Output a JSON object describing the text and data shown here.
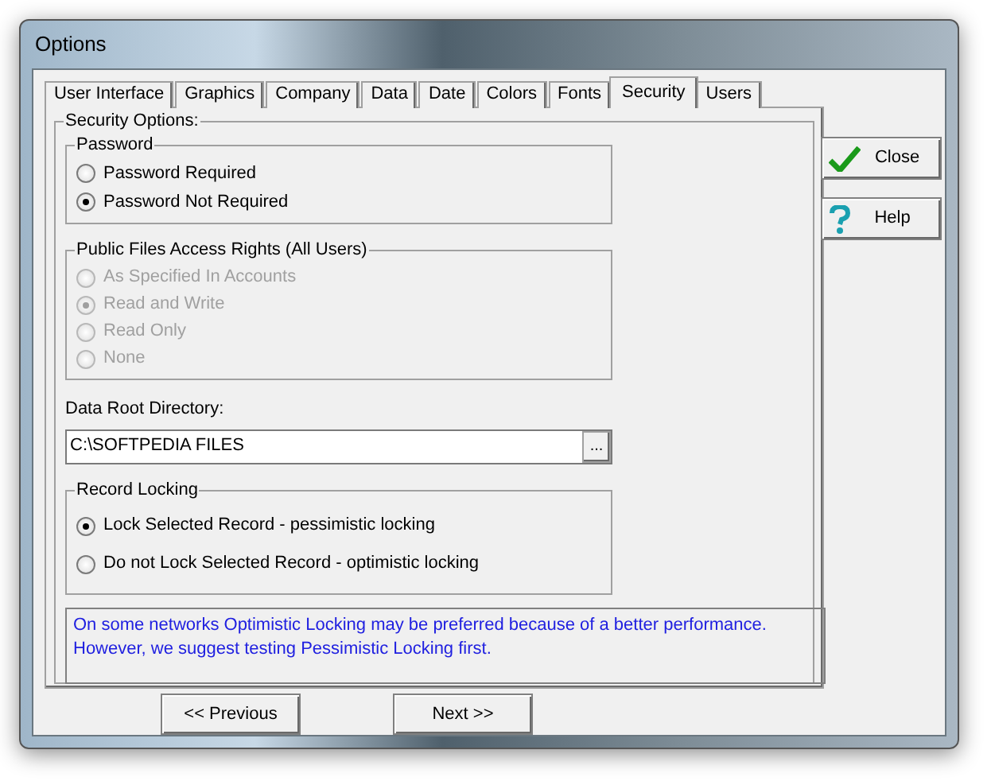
{
  "window": {
    "title": "Options"
  },
  "tabs": [
    {
      "label": "User Interface",
      "selected": false
    },
    {
      "label": "Graphics",
      "selected": false
    },
    {
      "label": "Company",
      "selected": false
    },
    {
      "label": "Data",
      "selected": false
    },
    {
      "label": "Date",
      "selected": false
    },
    {
      "label": "Colors",
      "selected": false
    },
    {
      "label": "Fonts",
      "selected": false
    },
    {
      "label": "Security",
      "selected": true
    },
    {
      "label": "Users",
      "selected": false
    }
  ],
  "security_options": {
    "title": "Security Options:",
    "password": {
      "title": "Password",
      "options": [
        {
          "label": "Password Required",
          "selected": false,
          "disabled": false
        },
        {
          "label": "Password Not Required",
          "selected": true,
          "disabled": false
        }
      ]
    },
    "public_files_access": {
      "title": "Public Files Access Rights (All Users)",
      "options": [
        {
          "label": "As Specified In Accounts",
          "selected": false,
          "disabled": true
        },
        {
          "label": "Read and Write",
          "selected": true,
          "disabled": true
        },
        {
          "label": "Read Only",
          "selected": false,
          "disabled": true
        },
        {
          "label": "None",
          "selected": false,
          "disabled": true
        }
      ]
    },
    "data_root_directory": {
      "label": "Data Root Directory:",
      "value": "C:\\SOFTPEDIA FILES",
      "browse": "..."
    },
    "record_locking": {
      "title": "Record Locking",
      "options": [
        {
          "label": "Lock Selected Record - pessimistic locking",
          "selected": true,
          "disabled": false
        },
        {
          "label": "Do not Lock Selected Record - optimistic locking",
          "selected": false,
          "disabled": false
        }
      ]
    },
    "note": "On some networks Optimistic Locking may be preferred because of a better performance. However, we suggest testing Pessimistic Locking first."
  },
  "side_buttons": [
    {
      "label": "Close",
      "kind": "check"
    },
    {
      "label": "Help",
      "kind": "question"
    }
  ],
  "nav_buttons": [
    {
      "label": "<< Previous"
    },
    {
      "label": "Next >>"
    }
  ]
}
